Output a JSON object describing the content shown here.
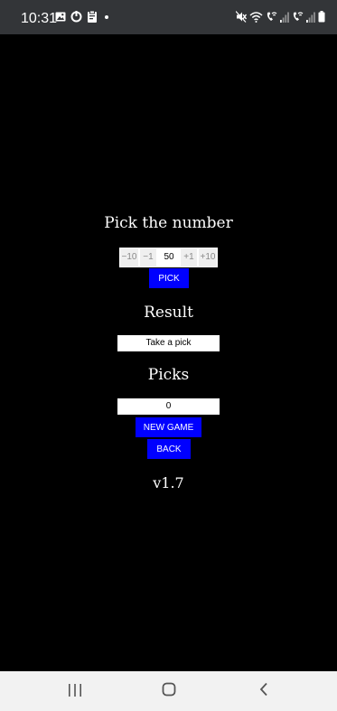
{
  "status_bar": {
    "time": "10:31",
    "left_icons": [
      "gallery-icon",
      "sync-icon",
      "clipboard-icon",
      "notification-dot-icon"
    ],
    "right_icons": [
      "mute-icon",
      "wifi-icon",
      "wifi-calling-icon",
      "signal-1-icon",
      "wifi-calling-2-icon",
      "signal-2-icon",
      "battery-icon"
    ]
  },
  "game": {
    "title": "Pick the number",
    "stepper": {
      "minus_ten": "−10",
      "minus_one": "−1",
      "value": "50",
      "plus_one": "+1",
      "plus_ten": "+10"
    },
    "pick_button": "Pick",
    "result_heading": "Result",
    "result_value": "Take a pick",
    "picks_heading": "Picks",
    "picks_value": "0",
    "new_game_button": "New game",
    "back_button": "Back",
    "version": "v1.7"
  },
  "colors": {
    "background": "#000000",
    "accent": "#0000ff",
    "status_bar": "#333538",
    "nav_bar": "#f2f2f2"
  },
  "nav_bar": {
    "icons": [
      "recent-apps-icon",
      "home-icon",
      "back-icon"
    ]
  }
}
